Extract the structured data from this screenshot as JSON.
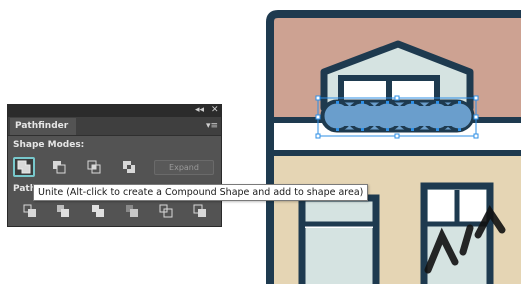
{
  "panel": {
    "tab_label": "Pathfinder",
    "collapse_glyph": "◂◂",
    "close_glyph": "✕",
    "menu_glyph": "▾≡",
    "shape_modes_label": "Shape Modes:",
    "pathfinders_label": "Path",
    "expand_label": "Expand",
    "shape_modes": [
      {
        "name": "unite",
        "icon": "unite-icon"
      },
      {
        "name": "minus-front",
        "icon": "minus-front-icon"
      },
      {
        "name": "intersect",
        "icon": "intersect-icon"
      },
      {
        "name": "exclude",
        "icon": "exclude-icon"
      }
    ],
    "pathfinders": [
      {
        "name": "divide",
        "icon": "divide-icon"
      },
      {
        "name": "trim",
        "icon": "trim-icon"
      },
      {
        "name": "merge",
        "icon": "merge-icon"
      },
      {
        "name": "crop",
        "icon": "crop-icon"
      },
      {
        "name": "outline",
        "icon": "outline-icon"
      },
      {
        "name": "minus-back",
        "icon": "minus-back-icon"
      }
    ]
  },
  "tooltip": {
    "text": "Unite (Alt-click to create a Compound Shape and add to shape area)"
  },
  "colors": {
    "outline": "#1e3a4f",
    "roof": "#cda292",
    "wall": "#e5d5b4",
    "window_glass": "#d5e3e1",
    "cloud_fill": "#6a9ecc",
    "selection": "#2d8fe6",
    "panel_bg": "#535353",
    "active_ring": "#78c8cc"
  }
}
